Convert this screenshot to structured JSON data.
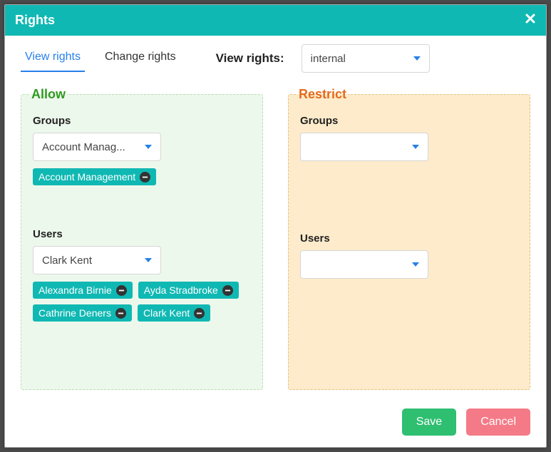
{
  "titlebar": {
    "title": "Rights"
  },
  "tabs": {
    "view": "View rights",
    "change": "Change rights"
  },
  "viewRights": {
    "label": "View rights:",
    "selected": "internal"
  },
  "allow": {
    "legend": "Allow",
    "groupsLabel": "Groups",
    "groupSelected": "Account Manag...",
    "groupTags": [
      "Account Management"
    ],
    "usersLabel": "Users",
    "userSelected": "Clark Kent",
    "userTags": [
      "Alexandra Birnie",
      "Ayda Stradbroke",
      "Cathrine Deners",
      "Clark Kent"
    ]
  },
  "restrict": {
    "legend": "Restrict",
    "groupsLabel": "Groups",
    "groupSelected": "",
    "usersLabel": "Users",
    "userSelected": ""
  },
  "footer": {
    "save": "Save",
    "cancel": "Cancel"
  }
}
